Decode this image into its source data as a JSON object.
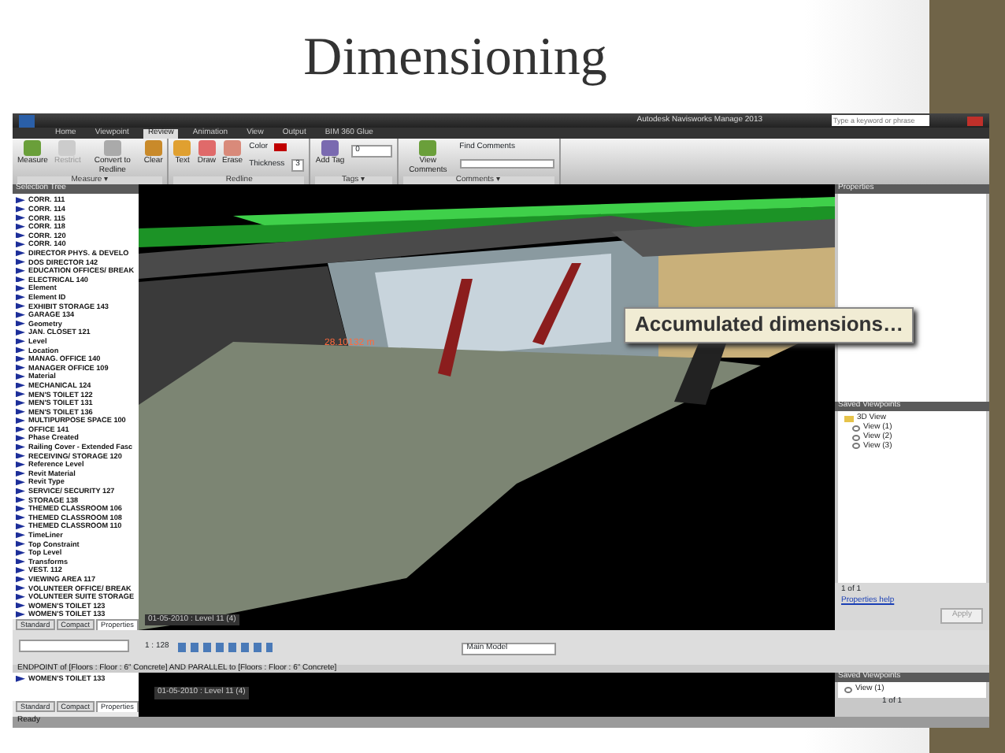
{
  "slide": {
    "title": "Dimensioning"
  },
  "window": {
    "title": "Autodesk Navisworks Manage 2013",
    "search": {
      "placeholder": "Type a keyword or phrase"
    }
  },
  "ribbon": {
    "tabs": [
      {
        "label": "Home",
        "selected": false
      },
      {
        "label": "Viewpoint",
        "selected": false
      },
      {
        "label": "Review",
        "selected": true
      },
      {
        "label": "Animation",
        "selected": false
      },
      {
        "label": "View",
        "selected": false
      },
      {
        "label": "Output",
        "selected": false
      },
      {
        "label": "BIM 360 Glue",
        "selected": false
      }
    ],
    "groups": [
      {
        "label": "Measure ▾",
        "buttons": [
          {
            "label": "Measure",
            "disabled": false
          },
          {
            "label": "Restrict",
            "disabled": true
          },
          {
            "label": "Convert to Redline",
            "disabled": false
          },
          {
            "label": "Clear",
            "disabled": false
          }
        ]
      },
      {
        "label": "Redline",
        "buttons": [
          {
            "label": "Text",
            "disabled": false
          },
          {
            "label": "Draw",
            "disabled": false
          },
          {
            "label": "Erase",
            "disabled": false
          }
        ],
        "color_label": "Color",
        "thickness_label": "Thickness",
        "thickness": "3"
      },
      {
        "label": "Tags ▾",
        "buttons": [
          {
            "label": "Add Tag",
            "disabled": false
          }
        ],
        "tag": "0"
      },
      {
        "label": "Comments ▾",
        "buttons": [
          {
            "label": "View Comments",
            "disabled": false
          }
        ],
        "find_label": "Find Comments"
      }
    ]
  },
  "selection_tree": {
    "title": "Selection Tree",
    "items": [
      "CORR. 111",
      "CORR. 114",
      "CORR. 115",
      "CORR. 118",
      "CORR. 120",
      "CORR. 140",
      "DIRECTOR PHYS. & DEVELO",
      "DOS DIRECTOR 142",
      "EDUCATION OFFICES/ BREAK",
      "ELECTRICAL 140",
      "Element",
      "Element ID",
      "EXHIBIT STORAGE 143",
      "GARAGE 134",
      "Geometry",
      "JAN. CLOSET 121",
      "Level",
      "Location",
      "MANAG. OFFICE 140",
      "MANAGER OFFICE 109",
      "Material",
      "MECHANICAL 124",
      "MEN'S TOILET 122",
      "MEN'S TOILET 131",
      "MEN'S TOILET 136",
      "MULTIPURPOSE SPACE 100",
      "OFFICE 141",
      "Phase Created",
      "Railing Cover - Extended Fasc",
      "RECEIVING/ STORAGE 120",
      "Reference Level",
      "Revit Material",
      "Revit Type",
      "SERVICE/ SECURITY 127",
      "STORAGE 138",
      "THEMED CLASSROOM 106",
      "THEMED CLASSROOM 108",
      "THEMED CLASSROOM 110",
      "TimeLiner",
      "Top Constraint",
      "Top Level",
      "Transforms",
      "VEST. 112",
      "VIEWING AREA 117",
      "VOLUNTEER OFFICE/ BREAK",
      "VOLUNTEER SUITE STORAGE",
      "WOMEN'S TOILET 123",
      "WOMEN'S TOILET 133"
    ],
    "tabs": [
      {
        "label": "Standard",
        "selected": false
      },
      {
        "label": "Compact",
        "selected": false
      },
      {
        "label": "Properties",
        "selected": true
      }
    ]
  },
  "viewport": {
    "measure_label": "28.10132 m",
    "callout": "Accumulated dimensions…",
    "overlay": "01-05-2010 : Level 11 (4)"
  },
  "properties": {
    "title": "Properties",
    "page": "1 of 1",
    "help_link": "Properties help",
    "apply": "Apply"
  },
  "saved_viewpoints": {
    "title": "Saved Viewpoints",
    "items": [
      {
        "label": "3D View",
        "children": [
          {
            "label": "View (1)"
          },
          {
            "label": "View (2)"
          },
          {
            "label": "View (3)"
          }
        ]
      }
    ]
  },
  "toolbar": {
    "scale": "1 : 128",
    "model": "Main Model"
  },
  "status_line": "ENDPOINT  of [Floors : Floor : 6\" Concrete] AND PARALLEL  to [Floors : Floor : 6\" Concrete]",
  "lower": {
    "tree_item": "WOMEN'S TOILET 133",
    "tabs": [
      {
        "label": "Standard",
        "selected": false
      },
      {
        "label": "Compact",
        "selected": false
      },
      {
        "label": "Properties",
        "selected": true
      }
    ],
    "overlay": "01-05-2010 : Level 11 (4)",
    "viewpoints_title": "Saved Viewpoints",
    "viewpoint": "View (1)",
    "page": "1 of 1"
  },
  "status": "Ready"
}
